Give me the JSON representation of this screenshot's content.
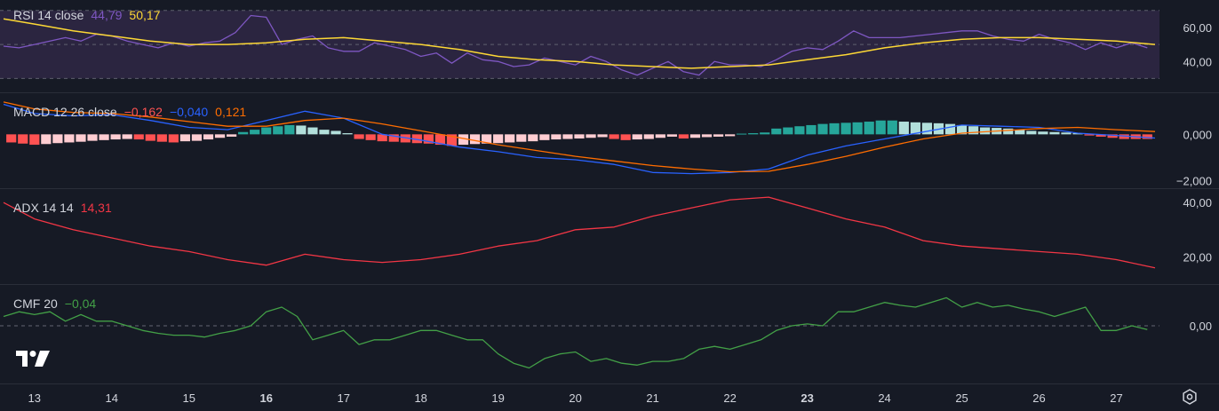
{
  "colors": {
    "bg": "#161a25",
    "rsi": "#7e57c2",
    "rsi_ma": "#fdd835",
    "rsi_band": "#2b2540",
    "macd": "#2962ff",
    "signal": "#ff6d00",
    "hist_pos_strong": "#26a69a",
    "hist_pos_weak": "#b2dfdb",
    "hist_neg_strong": "#ff5252",
    "hist_neg_weak": "#ffcdd2",
    "adx": "#f23645",
    "cmf": "#43a047",
    "axis_text": "#d1d4dc",
    "pane_border": "#2a2e39"
  },
  "legends": {
    "rsi": {
      "name": "RSI 14 close",
      "v1": "44,79",
      "v2": "50,17"
    },
    "macd": {
      "name": "MACD 12 26 close",
      "v1": "−0,162",
      "v2": "−0,040",
      "v3": "0,121"
    },
    "adx": {
      "name": "ADX 14 14",
      "v1": "14,31"
    },
    "cmf": {
      "name": "CMF 20",
      "v1": "−0,04"
    }
  },
  "time_axis": {
    "labels": [
      {
        "text": "13",
        "bold": false
      },
      {
        "text": "14",
        "bold": false
      },
      {
        "text": "15",
        "bold": false
      },
      {
        "text": "16",
        "bold": true
      },
      {
        "text": "17",
        "bold": false
      },
      {
        "text": "18",
        "bold": false
      },
      {
        "text": "19",
        "bold": false
      },
      {
        "text": "20",
        "bold": false
      },
      {
        "text": "21",
        "bold": false
      },
      {
        "text": "22",
        "bold": false
      },
      {
        "text": "23",
        "bold": true
      },
      {
        "text": "24",
        "bold": false
      },
      {
        "text": "25",
        "bold": false
      },
      {
        "text": "26",
        "bold": false
      },
      {
        "text": "27",
        "bold": false
      }
    ]
  },
  "logo_icon": "tradingview-logo-icon",
  "settings_icon": "gear-icon",
  "chart_data": [
    {
      "type": "line",
      "title": "RSI 14 close",
      "x_range": [
        12.6,
        27.5
      ],
      "ylim": [
        25,
        73
      ],
      "y_ticks": [
        {
          "value": 60,
          "label": "60,00"
        },
        {
          "value": 40,
          "label": "40,00"
        }
      ],
      "bands": [
        30,
        50,
        70
      ],
      "series": [
        {
          "name": "RSI",
          "x": [
            12.6,
            12.8,
            13.0,
            13.2,
            13.4,
            13.6,
            13.8,
            14.0,
            14.2,
            14.4,
            14.6,
            14.8,
            15.0,
            15.2,
            15.4,
            15.6,
            15.8,
            16.0,
            16.2,
            16.4,
            16.6,
            16.8,
            17.0,
            17.2,
            17.4,
            17.6,
            17.8,
            18.0,
            18.2,
            18.4,
            18.6,
            18.8,
            19.0,
            19.2,
            19.4,
            19.6,
            19.8,
            20.0,
            20.2,
            20.4,
            20.6,
            20.8,
            21.0,
            21.2,
            21.4,
            21.6,
            21.8,
            22.0,
            22.2,
            22.4,
            22.6,
            22.8,
            23.0,
            23.2,
            23.4,
            23.6,
            23.8,
            24.0,
            24.2,
            24.4,
            24.6,
            24.8,
            25.0,
            25.2,
            25.4,
            25.6,
            25.8,
            26.0,
            26.2,
            26.4,
            26.6,
            26.8,
            27.0,
            27.2,
            27.4
          ],
          "values": [
            49,
            48,
            50,
            52,
            54,
            52,
            56,
            55,
            52,
            50,
            48,
            51,
            49,
            51,
            52,
            57,
            67,
            66,
            50,
            53,
            55,
            48,
            46,
            46,
            51,
            49,
            47,
            43,
            45,
            39,
            45,
            41,
            40,
            37,
            38,
            42,
            40,
            38,
            43,
            40,
            35,
            32,
            36,
            40,
            34,
            32,
            40,
            38,
            38,
            37,
            41,
            46,
            48,
            47,
            52,
            58,
            54,
            54,
            54,
            55,
            56,
            57,
            58,
            58,
            55,
            53,
            52,
            56,
            53,
            51,
            47,
            51,
            48,
            51,
            48
          ]
        },
        {
          "name": "RSI-based MA",
          "x": [
            12.6,
            13.0,
            13.5,
            14.0,
            14.5,
            15.0,
            15.5,
            16.0,
            16.5,
            17.0,
            17.5,
            18.0,
            18.5,
            19.0,
            19.5,
            20.0,
            20.5,
            21.0,
            21.5,
            22.0,
            22.5,
            23.0,
            23.5,
            24.0,
            24.5,
            25.0,
            25.5,
            26.0,
            26.5,
            27.0,
            27.5
          ],
          "values": [
            65,
            62,
            58,
            55,
            52,
            50,
            50,
            51,
            53,
            54,
            52,
            50,
            47,
            43,
            41,
            40,
            38,
            37,
            36,
            37,
            38,
            41,
            44,
            48,
            51,
            53,
            54,
            54,
            53,
            52,
            50
          ]
        }
      ]
    },
    {
      "type": "bar",
      "title": "MACD 12 26 close",
      "x_range": [
        12.6,
        27.5
      ],
      "ylim": [
        -2.1,
        1.55
      ],
      "y_ticks": [
        {
          "value": 0,
          "label": "0,000"
        },
        {
          "value": -2,
          "label": "−2,000"
        }
      ],
      "histogram": {
        "x": [
          12.7,
          12.85,
          13.0,
          13.15,
          13.3,
          13.45,
          13.6,
          13.75,
          13.9,
          14.05,
          14.2,
          14.35,
          14.5,
          14.65,
          14.8,
          14.95,
          15.1,
          15.25,
          15.4,
          15.55,
          15.7,
          15.85,
          16.0,
          16.15,
          16.3,
          16.45,
          16.6,
          16.75,
          16.9,
          17.05,
          17.2,
          17.35,
          17.5,
          17.65,
          17.8,
          17.95,
          18.1,
          18.25,
          18.4,
          18.55,
          18.7,
          18.85,
          19.0,
          19.15,
          19.3,
          19.45,
          19.6,
          19.75,
          19.9,
          20.05,
          20.2,
          20.35,
          20.5,
          20.65,
          20.8,
          20.95,
          21.1,
          21.25,
          21.4,
          21.55,
          21.7,
          21.85,
          22.0,
          22.15,
          22.3,
          22.45,
          22.6,
          22.75,
          22.9,
          23.05,
          23.2,
          23.35,
          23.5,
          23.65,
          23.8,
          23.95,
          24.1,
          24.25,
          24.4,
          24.55,
          24.7,
          24.85,
          25.0,
          25.15,
          25.3,
          25.45,
          25.6,
          25.75,
          25.9,
          26.05,
          26.2,
          26.35,
          26.5,
          26.65,
          26.8,
          26.95,
          27.1,
          27.25,
          27.4
        ],
        "values": [
          -0.35,
          -0.4,
          -0.45,
          -0.42,
          -0.38,
          -0.35,
          -0.32,
          -0.28,
          -0.25,
          -0.22,
          -0.2,
          -0.22,
          -0.28,
          -0.32,
          -0.35,
          -0.3,
          -0.28,
          -0.22,
          -0.15,
          -0.1,
          0.1,
          0.2,
          0.3,
          0.35,
          0.4,
          0.38,
          0.3,
          0.2,
          0.15,
          0.05,
          -0.2,
          -0.25,
          -0.3,
          -0.32,
          -0.35,
          -0.38,
          -0.4,
          -0.45,
          -0.5,
          -0.45,
          -0.42,
          -0.4,
          -0.38,
          -0.35,
          -0.32,
          -0.3,
          -0.25,
          -0.22,
          -0.2,
          -0.18,
          -0.15,
          -0.12,
          -0.2,
          -0.25,
          -0.22,
          -0.2,
          -0.15,
          -0.1,
          -0.18,
          -0.15,
          -0.12,
          -0.1,
          -0.08,
          0.03,
          0.05,
          0.08,
          0.25,
          0.3,
          0.35,
          0.4,
          0.45,
          0.48,
          0.5,
          0.52,
          0.55,
          0.6,
          0.6,
          0.55,
          0.52,
          0.5,
          0.48,
          0.45,
          0.4,
          0.35,
          0.3,
          0.28,
          0.25,
          0.2,
          0.15,
          0.12,
          0.1,
          0.08,
          0.05,
          -0.05,
          -0.1,
          -0.15,
          -0.2,
          -0.2,
          -0.2
        ]
      },
      "series": [
        {
          "name": "MACD",
          "x": [
            12.6,
            13.0,
            13.5,
            14.0,
            14.5,
            15.0,
            15.5,
            16.0,
            16.5,
            17.0,
            17.5,
            18.0,
            18.5,
            19.0,
            19.5,
            20.0,
            20.5,
            21.0,
            21.5,
            22.0,
            22.5,
            23.0,
            23.5,
            24.0,
            24.5,
            25.0,
            25.5,
            26.0,
            26.5,
            27.0,
            27.5
          ],
          "values": [
            1.3,
            0.9,
            0.8,
            0.85,
            0.6,
            0.3,
            0.2,
            0.6,
            1.0,
            0.7,
            0.0,
            -0.25,
            -0.55,
            -0.75,
            -1.0,
            -1.1,
            -1.3,
            -1.65,
            -1.7,
            -1.65,
            -1.5,
            -0.9,
            -0.5,
            -0.2,
            0.1,
            0.4,
            0.35,
            0.3,
            0.05,
            -0.05,
            -0.16
          ]
        },
        {
          "name": "Signal",
          "x": [
            12.6,
            13.0,
            13.5,
            14.0,
            14.5,
            15.0,
            15.5,
            16.0,
            16.5,
            17.0,
            17.5,
            18.0,
            18.5,
            19.0,
            19.5,
            20.0,
            20.5,
            21.0,
            21.5,
            22.0,
            22.5,
            23.0,
            23.5,
            24.0,
            24.5,
            25.0,
            25.5,
            26.0,
            26.5,
            27.0,
            27.5
          ],
          "values": [
            1.4,
            1.1,
            0.95,
            0.9,
            0.75,
            0.55,
            0.35,
            0.35,
            0.6,
            0.7,
            0.45,
            0.15,
            -0.15,
            -0.45,
            -0.7,
            -0.95,
            -1.15,
            -1.35,
            -1.5,
            -1.62,
            -1.6,
            -1.3,
            -0.95,
            -0.55,
            -0.2,
            0.05,
            0.15,
            0.25,
            0.3,
            0.2,
            0.12
          ]
        }
      ]
    },
    {
      "type": "line",
      "title": "ADX 14 14",
      "x_range": [
        12.6,
        27.5
      ],
      "ylim": [
        12,
        43
      ],
      "y_ticks": [
        {
          "value": 40,
          "label": "40,00"
        },
        {
          "value": 20,
          "label": "20,00"
        }
      ],
      "series": [
        {
          "name": "ADX",
          "x": [
            12.6,
            13.0,
            13.5,
            14.0,
            14.5,
            15.0,
            15.5,
            16.0,
            16.5,
            17.0,
            17.5,
            18.0,
            18.5,
            19.0,
            19.5,
            20.0,
            20.5,
            21.0,
            21.5,
            22.0,
            22.5,
            23.0,
            23.5,
            24.0,
            24.5,
            25.0,
            25.5,
            26.0,
            26.5,
            27.0,
            27.5
          ],
          "values": [
            40,
            34,
            30,
            27,
            24,
            22,
            19,
            17,
            21,
            19,
            18,
            19,
            21,
            24,
            26,
            30,
            31,
            35,
            38,
            41,
            42,
            38,
            34,
            31,
            26,
            24,
            23,
            22,
            21,
            19,
            16
          ]
        }
      ]
    },
    {
      "type": "line",
      "title": "CMF 20",
      "x_range": [
        12.6,
        27.5
      ],
      "ylim": [
        -0.55,
        0.38
      ],
      "y_ticks": [
        {
          "value": 0,
          "label": "0,00"
        }
      ],
      "zero_line": true,
      "series": [
        {
          "name": "CMF",
          "x": [
            12.6,
            12.8,
            13.0,
            13.2,
            13.4,
            13.6,
            13.8,
            14.0,
            14.2,
            14.4,
            14.6,
            14.8,
            15.0,
            15.2,
            15.4,
            15.6,
            15.8,
            16.0,
            16.2,
            16.4,
            16.6,
            16.8,
            17.0,
            17.2,
            17.4,
            17.6,
            17.8,
            18.0,
            18.2,
            18.4,
            18.6,
            18.8,
            19.0,
            19.2,
            19.4,
            19.6,
            19.8,
            20.0,
            20.2,
            20.4,
            20.6,
            20.8,
            21.0,
            21.2,
            21.4,
            21.6,
            21.8,
            22.0,
            22.2,
            22.4,
            22.6,
            22.8,
            23.0,
            23.2,
            23.4,
            23.6,
            23.8,
            24.0,
            24.2,
            24.4,
            24.6,
            24.8,
            25.0,
            25.2,
            25.4,
            25.6,
            25.8,
            26.0,
            26.2,
            26.4,
            26.6,
            26.8,
            27.0,
            27.2,
            27.4
          ],
          "values": [
            0.1,
            0.15,
            0.12,
            0.15,
            0.05,
            0.12,
            0.05,
            0.05,
            0.0,
            -0.05,
            -0.08,
            -0.1,
            -0.1,
            -0.12,
            -0.08,
            -0.05,
            0.0,
            0.15,
            0.2,
            0.1,
            -0.15,
            -0.1,
            -0.05,
            -0.2,
            -0.15,
            -0.15,
            -0.1,
            -0.05,
            -0.05,
            -0.1,
            -0.15,
            -0.15,
            -0.3,
            -0.4,
            -0.45,
            -0.35,
            -0.3,
            -0.28,
            -0.38,
            -0.35,
            -0.4,
            -0.42,
            -0.38,
            -0.38,
            -0.35,
            -0.25,
            -0.22,
            -0.25,
            -0.2,
            -0.15,
            -0.05,
            0.0,
            0.02,
            0.0,
            0.15,
            0.15,
            0.2,
            0.25,
            0.22,
            0.2,
            0.25,
            0.3,
            0.2,
            0.25,
            0.2,
            0.22,
            0.18,
            0.15,
            0.1,
            0.15,
            0.2,
            -0.05,
            -0.05,
            0.0,
            -0.04
          ]
        }
      ]
    }
  ]
}
